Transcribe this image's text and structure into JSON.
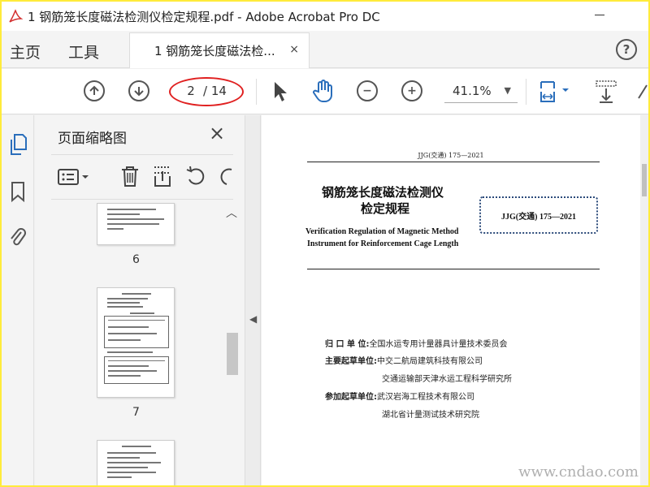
{
  "window": {
    "title": "1 钢筋笼长度磁法检测仪检定规程.pdf - Adobe Acrobat Pro DC"
  },
  "tabs": {
    "home": "主页",
    "tools": "工具",
    "document": "1 钢筋笼长度磁法检...",
    "close": "×"
  },
  "toolbar": {
    "current_page": "2",
    "total_pages": "/ 14",
    "zoom": "41.1%"
  },
  "thumbnails": {
    "title": "页面缩略图",
    "close": "×",
    "pages": [
      {
        "number": "6"
      },
      {
        "number": "7"
      }
    ]
  },
  "document": {
    "code_top": "JJG(交通) 175—2021",
    "title_cn_line1": "钢筋笼长度磁法检测仪",
    "title_cn_line2": "检定规程",
    "title_en_line1": "Verification Regulation of Magnetic Method",
    "title_en_line2": "Instrument for Reinforcement Cage Length",
    "stamp_code": "JJG(交通) 175—2021",
    "org": {
      "unit_label": "归 口 单 位:",
      "unit_value": "全国水运专用计量器具计量技术委员会",
      "main_label": "主要起草单位:",
      "main_values": [
        "中交二航局建筑科技有限公司",
        "交通运输部天津水运工程科学研究所"
      ],
      "join_label": "参加起草单位:",
      "join_values": [
        "武汉岩海工程技术有限公司",
        "湖北省计量测试技术研究院"
      ]
    }
  },
  "watermark": "www.cndao.com",
  "colors": {
    "frame": "#ffeb3b",
    "annotation_ellipse": "#e02020",
    "accent_blue": "#2a6ebb"
  }
}
